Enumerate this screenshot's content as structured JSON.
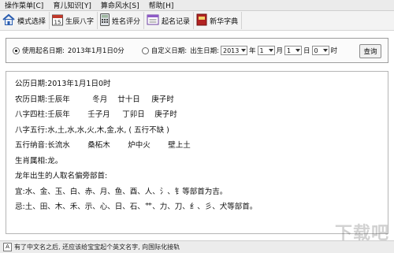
{
  "menu": {
    "items": [
      "操作菜单[C]",
      "育儿知识[Y]",
      "算命风水[S]",
      "帮助[H]"
    ]
  },
  "toolbar": {
    "mode_label": "模式选择",
    "birth_label": "生辰八字",
    "name_score_label": "姓名评分",
    "record_label": "起名记录",
    "dict_label": "新华字典",
    "calendar_icon_text": "15"
  },
  "options": {
    "use_date_label": "使用起名日期:",
    "use_date_value": "2013年1月1日0分",
    "custom_date_label": "自定义日期:",
    "birth_date_label": "出生日期:",
    "year_value": "2013",
    "year_unit": "年",
    "month_value": "1",
    "month_unit": "月",
    "day_value": "1",
    "day_unit": "日",
    "hour_value": "0",
    "hour_unit": "时",
    "query_label": "查询"
  },
  "results": {
    "gregorian_label": "公历日期:",
    "gregorian_value": "2013年1月1日0时",
    "lunar_label": "农历日期:",
    "lunar_value": [
      "壬辰年",
      "冬月",
      "廿十日",
      "庚子时"
    ],
    "bazi_label": "八字四柱:",
    "bazi_value": [
      "壬辰年",
      "壬子月",
      "丁卯日",
      "庚子时"
    ],
    "wuxing_label": "八字五行:",
    "wuxing_value": "水,土,水,水,火,木,金,水, ( 五行不缺 )",
    "nayin_label": "五行纳音:",
    "nayin_value": [
      "长流水",
      "桑柘木",
      "炉中火",
      "壁上土"
    ],
    "zodiac_label": "生肖属相:",
    "zodiac_value": "龙。",
    "radical_heading": "龙年出生的人取名偏旁部首:",
    "good_label": "宜:",
    "good_value": "水、金、玉、白、赤、月、鱼、酉、人、氵、钅等部首为吉。",
    "bad_label": "忌:",
    "bad_value": "土、田、木、禾、示、心、日、石、艹、力、刀、纟、彡、犬等部首。"
  },
  "status": {
    "icon_text": "A",
    "text": "有了中文名之后, 还应该给宝宝起个英文名字, 向国际化接轨"
  },
  "watermark": {
    "text": "下载吧"
  },
  "colors": {
    "menubar_bg": "#ebebeb",
    "toolbar_bg": "#f3f3f3",
    "panel_border": "#9e9e9e"
  }
}
